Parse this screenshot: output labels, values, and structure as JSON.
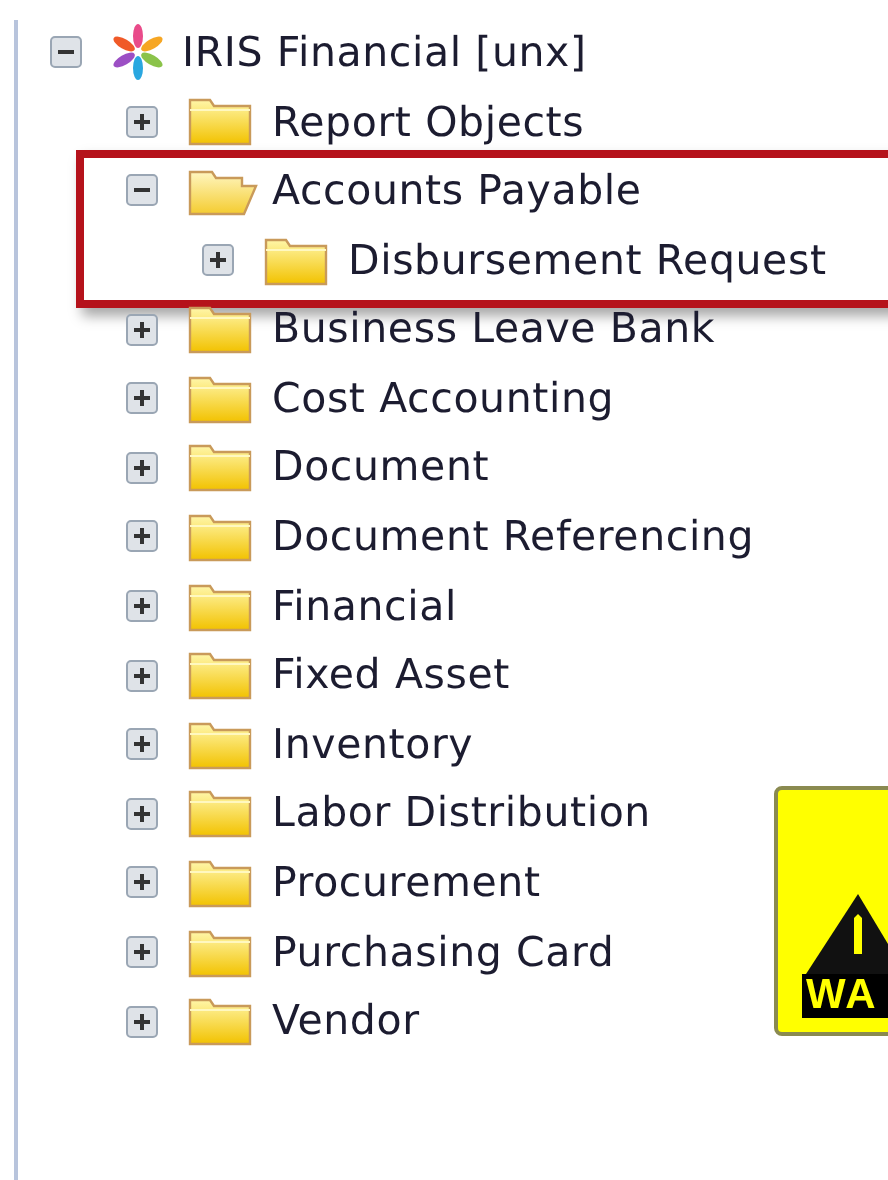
{
  "tree": [
    {
      "label": "IRIS Financial [unx]",
      "kind": "root",
      "expanded": true,
      "highlighted": false,
      "children": [
        {
          "label": "Report Objects",
          "kind": "folder",
          "expanded": false,
          "highlighted": false
        },
        {
          "label": "Accounts Payable",
          "kind": "folder",
          "expanded": true,
          "highlighted": true,
          "children": [
            {
              "label": "Disbursement Request",
              "kind": "folder",
              "expanded": false,
              "highlighted": false
            }
          ]
        },
        {
          "label": "Business Leave Bank",
          "kind": "folder",
          "expanded": false,
          "highlighted": false
        },
        {
          "label": "Cost Accounting",
          "kind": "folder",
          "expanded": false,
          "highlighted": false
        },
        {
          "label": "Document",
          "kind": "folder",
          "expanded": false,
          "highlighted": false
        },
        {
          "label": "Document Referencing",
          "kind": "folder",
          "expanded": false,
          "highlighted": false
        },
        {
          "label": "Financial",
          "kind": "folder",
          "expanded": false,
          "highlighted": false
        },
        {
          "label": "Fixed Asset",
          "kind": "folder",
          "expanded": false,
          "highlighted": false
        },
        {
          "label": "Inventory",
          "kind": "folder",
          "expanded": false,
          "highlighted": false
        },
        {
          "label": "Labor Distribution",
          "kind": "folder",
          "expanded": false,
          "highlighted": false
        },
        {
          "label": "Procurement",
          "kind": "folder",
          "expanded": false,
          "highlighted": false
        },
        {
          "label": "Purchasing Card",
          "kind": "folder",
          "expanded": false,
          "highlighted": false
        },
        {
          "label": "Vendor",
          "kind": "folder",
          "expanded": false,
          "highlighted": false
        }
      ]
    }
  ],
  "warning_sign": {
    "label": "WA"
  }
}
